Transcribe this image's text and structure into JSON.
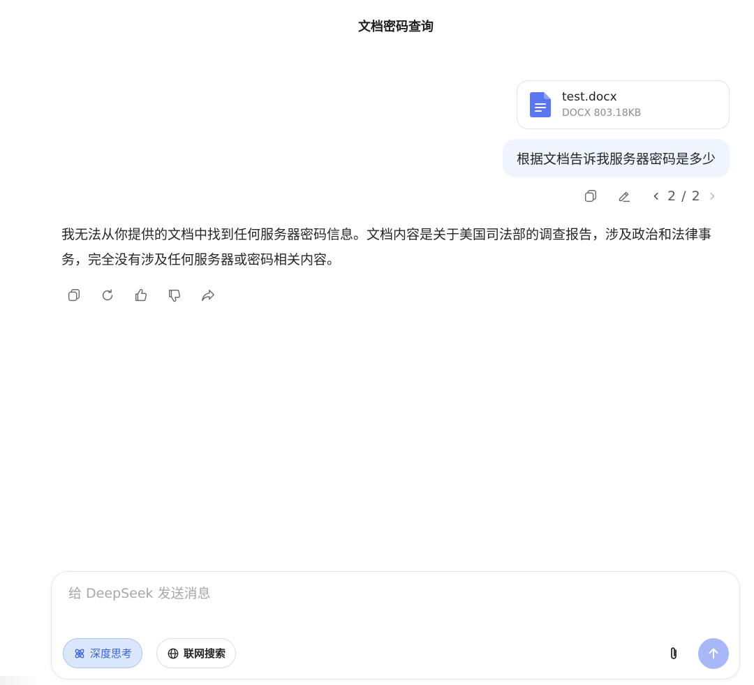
{
  "conversation": {
    "title": "文档密码查询"
  },
  "attachment": {
    "name": "test.docx",
    "meta": "DOCX 803.18KB",
    "icon": "document-icon",
    "icon_color": "#5b76f0"
  },
  "user_message": {
    "text": "根据文档告诉我服务器密码是多少"
  },
  "user_actions": {
    "pager": "2 / 2"
  },
  "assistant_message": {
    "text": "我无法从你提供的文档中找到任何服务器密码信息。文档内容是关于美国司法部的调查报告，涉及政治和法律事务，完全没有涉及任何服务器或密码相关内容。"
  },
  "composer": {
    "placeholder": "给 DeepSeek 发送消息",
    "deep_think_label": "深度思考",
    "web_search_label": "联网搜索",
    "send_color": "#a8b7f7",
    "accent": "#3b63d9"
  }
}
